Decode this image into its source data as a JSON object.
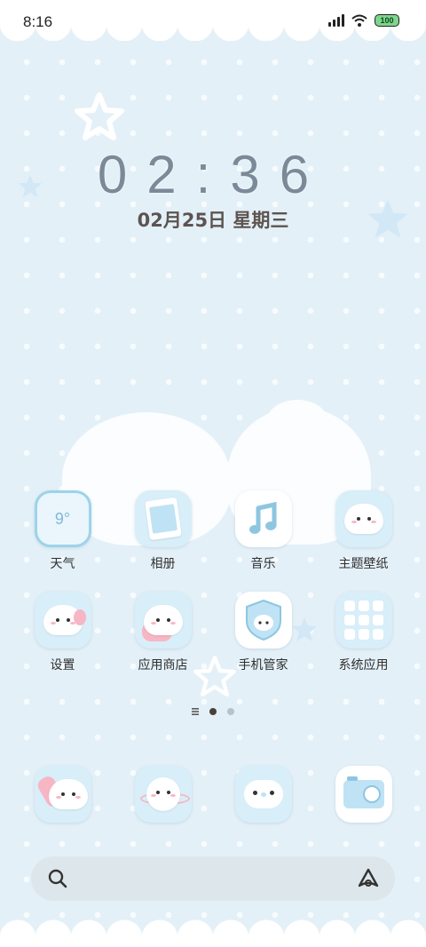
{
  "status_bar": {
    "time": "8:16",
    "battery": "100",
    "icons": [
      "signal-icon",
      "wifi-icon",
      "battery-icon"
    ]
  },
  "clock": {
    "time": "02:36",
    "date": "02月25日 星期三"
  },
  "apps": [
    {
      "label": "天气",
      "icon": "weather-icon",
      "temp": "9°"
    },
    {
      "label": "相册",
      "icon": "gallery-icon"
    },
    {
      "label": "音乐",
      "icon": "music-icon"
    },
    {
      "label": "主题壁纸",
      "icon": "theme-icon"
    },
    {
      "label": "设置",
      "icon": "settings-icon"
    },
    {
      "label": "应用商店",
      "icon": "app-store-icon"
    },
    {
      "label": "手机管家",
      "icon": "phone-manager-icon"
    },
    {
      "label": "系统应用",
      "icon": "system-apps-icon"
    }
  ],
  "page_indicator": {
    "pages": 2,
    "current": 1
  },
  "dock": [
    {
      "icon": "phone-icon"
    },
    {
      "icon": "browser-icon"
    },
    {
      "icon": "messages-icon"
    },
    {
      "icon": "camera-icon"
    }
  ],
  "search_bar": {
    "icons": [
      "search-icon",
      "assistant-icon"
    ]
  },
  "colors": {
    "background": "#e3f0f8",
    "icon_bg": "#d8eef9",
    "accent_pink": "#f7b6c4"
  }
}
